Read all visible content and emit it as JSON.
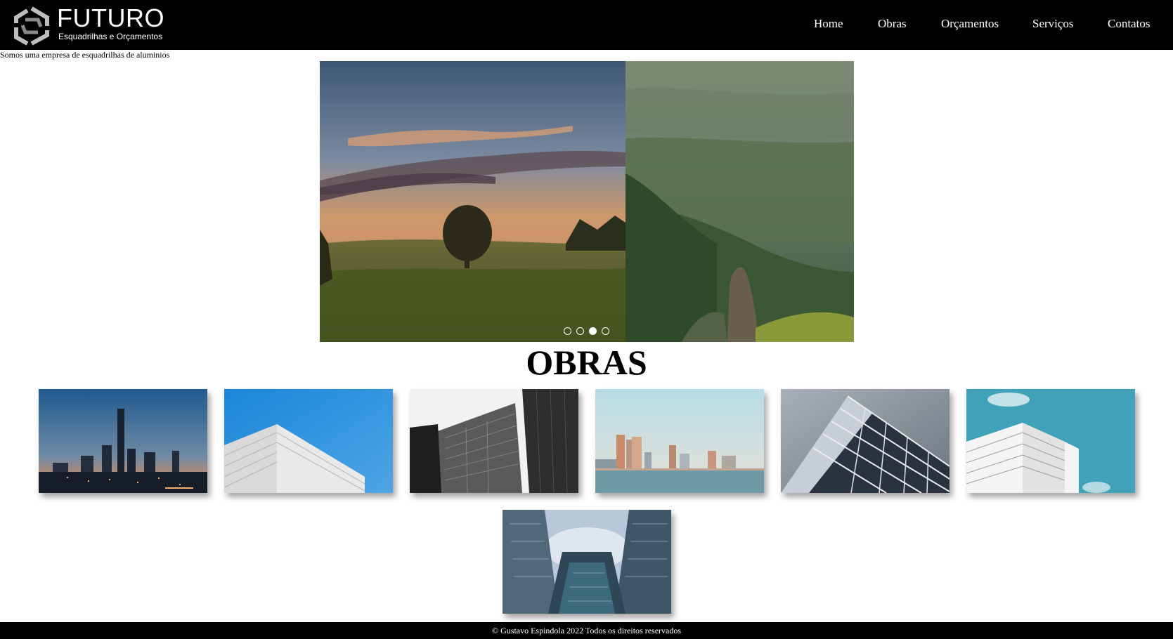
{
  "header": {
    "logo_title": "FUTURO",
    "logo_subtitle": "Esquadrilhas e Orçamentos",
    "nav": [
      "Home",
      "Obras",
      "Orçamentos",
      "Serviços",
      "Contatos"
    ]
  },
  "tagline": "Somos uma empresa de esquadrilhas de aluminios",
  "slider": {
    "slide_count": 4,
    "active_index": 2
  },
  "obras": {
    "title": "OBRAS",
    "images": [
      "city-skyline-night-image",
      "white-building-blue-sky-image",
      "glass-skyscrapers-bw-image",
      "city-waterfront-skyline-image",
      "glass-tower-image",
      "white-apartment-building-image",
      "skyscrapers-looking-up-image"
    ]
  },
  "footer": {
    "text": "© Gustavo Espindola 2022 Todos os direitos reservados"
  },
  "colors": {
    "header_bg": "#000000",
    "footer_bg": "#000000",
    "text_on_dark": "#ffffff"
  }
}
